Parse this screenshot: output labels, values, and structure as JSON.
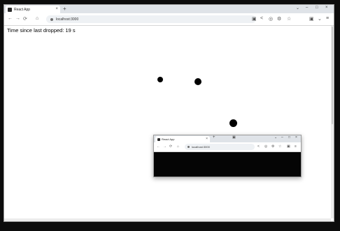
{
  "main_window": {
    "tab_title": "React App",
    "url": "localhost:3000",
    "timer_text": "Time since last dropped: 19 s"
  },
  "mini_window": {
    "tab_title": "React App",
    "url": "localhost:3000"
  },
  "icons": {
    "back": "←",
    "forward": "→",
    "reload": "⟳",
    "home": "⌂",
    "new_tab": "+",
    "close_tab": "×",
    "minimize": "–",
    "maximize": "□",
    "close": "×",
    "dropdown": "⌄",
    "star": "☆",
    "share": "<",
    "shield": "◎",
    "extension": "⚙",
    "menu": "≡",
    "screenshot": "▣"
  },
  "colors": {
    "page_background": "#ffffff",
    "dot": "#000000",
    "tab_strip": "#dfe3e8",
    "mini_page": "#050505"
  }
}
